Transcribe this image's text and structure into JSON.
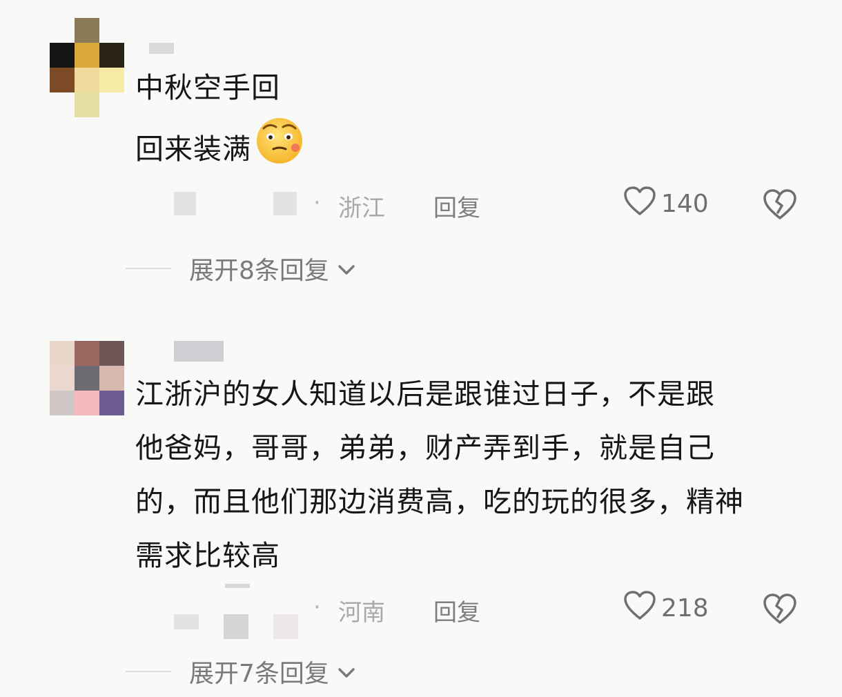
{
  "comments": [
    {
      "text_lines": [
        "中秋空手回",
        "回来装满"
      ],
      "emoji": "sly-face-emoji",
      "region": "浙江",
      "reply_label": "回复",
      "like_count": "140",
      "expand_label": "展开8条回复"
    },
    {
      "text_lines": [
        "江浙沪的女人知道以后是跟谁过日子，不是跟",
        "他爸妈，哥哥，弟弟，财产弄到手，就是自己",
        "的，而且他们那边消费高，吃的玩的很多，精神",
        "需求比较高"
      ],
      "region": "河南",
      "reply_label": "回复",
      "like_count": "218",
      "expand_label": "展开7条回复"
    }
  ],
  "colors": {
    "background": "#f9f9f7",
    "text": "#161616",
    "meta": "#a9a9a9",
    "reply": "#7e7e7e"
  },
  "icons": {
    "like": "heart-outline-icon",
    "dislike": "broken-heart-icon",
    "expand": "chevron-down-icon"
  }
}
